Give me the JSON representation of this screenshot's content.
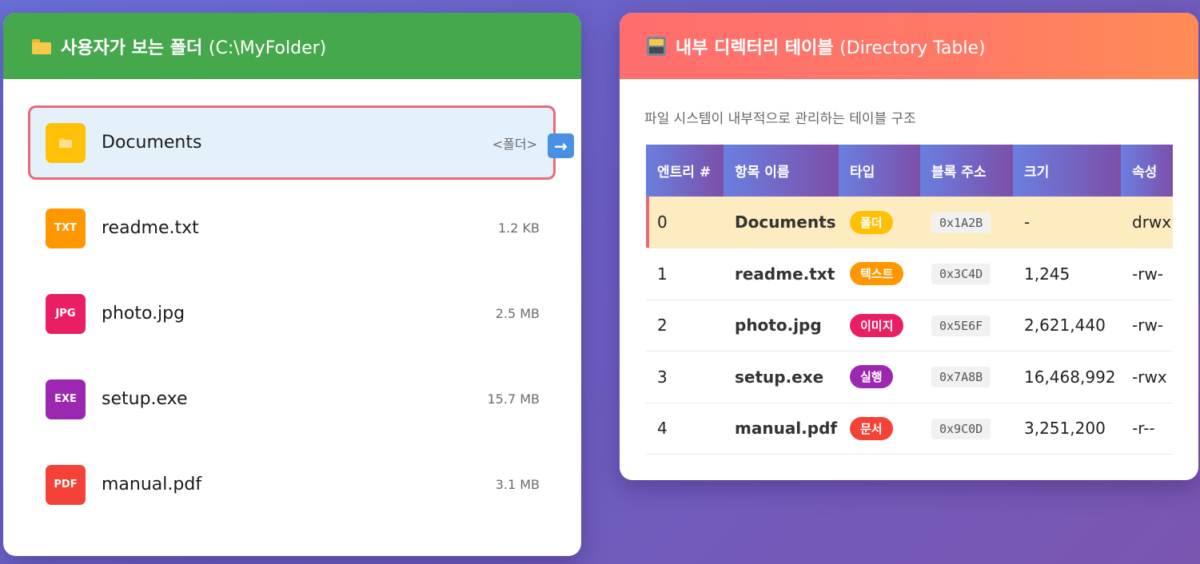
{
  "left_panel": {
    "title": "사용자가 보는 폴더",
    "path": "(C:\\MyFolder)",
    "items": [
      {
        "name": "Documents",
        "meta": "<폴더>",
        "icon": "folder-icon",
        "icon_label": "",
        "color": "#ffc107"
      },
      {
        "name": "readme.txt",
        "meta": "1.2 KB",
        "icon": "txt-file-icon",
        "icon_label": "TXT",
        "color": "#ff9800"
      },
      {
        "name": "photo.jpg",
        "meta": "2.5 MB",
        "icon": "jpg-file-icon",
        "icon_label": "JPG",
        "color": "#e91e63"
      },
      {
        "name": "setup.exe",
        "meta": "15.7 MB",
        "icon": "exe-file-icon",
        "icon_label": "EXE",
        "color": "#9c27b0"
      },
      {
        "name": "manual.pdf",
        "meta": "3.1 MB",
        "icon": "pdf-file-icon",
        "icon_label": "PDF",
        "color": "#f44336"
      }
    ],
    "arrow": "→"
  },
  "right_panel": {
    "title": "내부 디렉터리 테이블",
    "subtitle": "(Directory Table)",
    "description": "파일 시스템이 내부적으로 관리하는 테이블 구조",
    "columns": [
      "엔트리 #",
      "항목 이름",
      "타입",
      "블록 주소",
      "크기",
      "속성"
    ],
    "rows": [
      {
        "entry": "0",
        "name": "Documents",
        "type": "폴더",
        "type_color": "#ffc107",
        "block": "0x1A2B",
        "size": "-",
        "attr": "drwx"
      },
      {
        "entry": "1",
        "name": "readme.txt",
        "type": "텍스트",
        "type_color": "#ff9800",
        "block": "0x3C4D",
        "size": "1,245",
        "attr": "-rw-"
      },
      {
        "entry": "2",
        "name": "photo.jpg",
        "type": "이미지",
        "type_color": "#e91e63",
        "block": "0x5E6F",
        "size": "2,621,440",
        "attr": "-rw-"
      },
      {
        "entry": "3",
        "name": "setup.exe",
        "type": "실행",
        "type_color": "#9c27b0",
        "block": "0x7A8B",
        "size": "16,468,992",
        "attr": "-rwx"
      },
      {
        "entry": "4",
        "name": "manual.pdf",
        "type": "문서",
        "type_color": "#f44336",
        "block": "0x9C0D",
        "size": "3,251,200",
        "attr": "-r--"
      }
    ]
  }
}
